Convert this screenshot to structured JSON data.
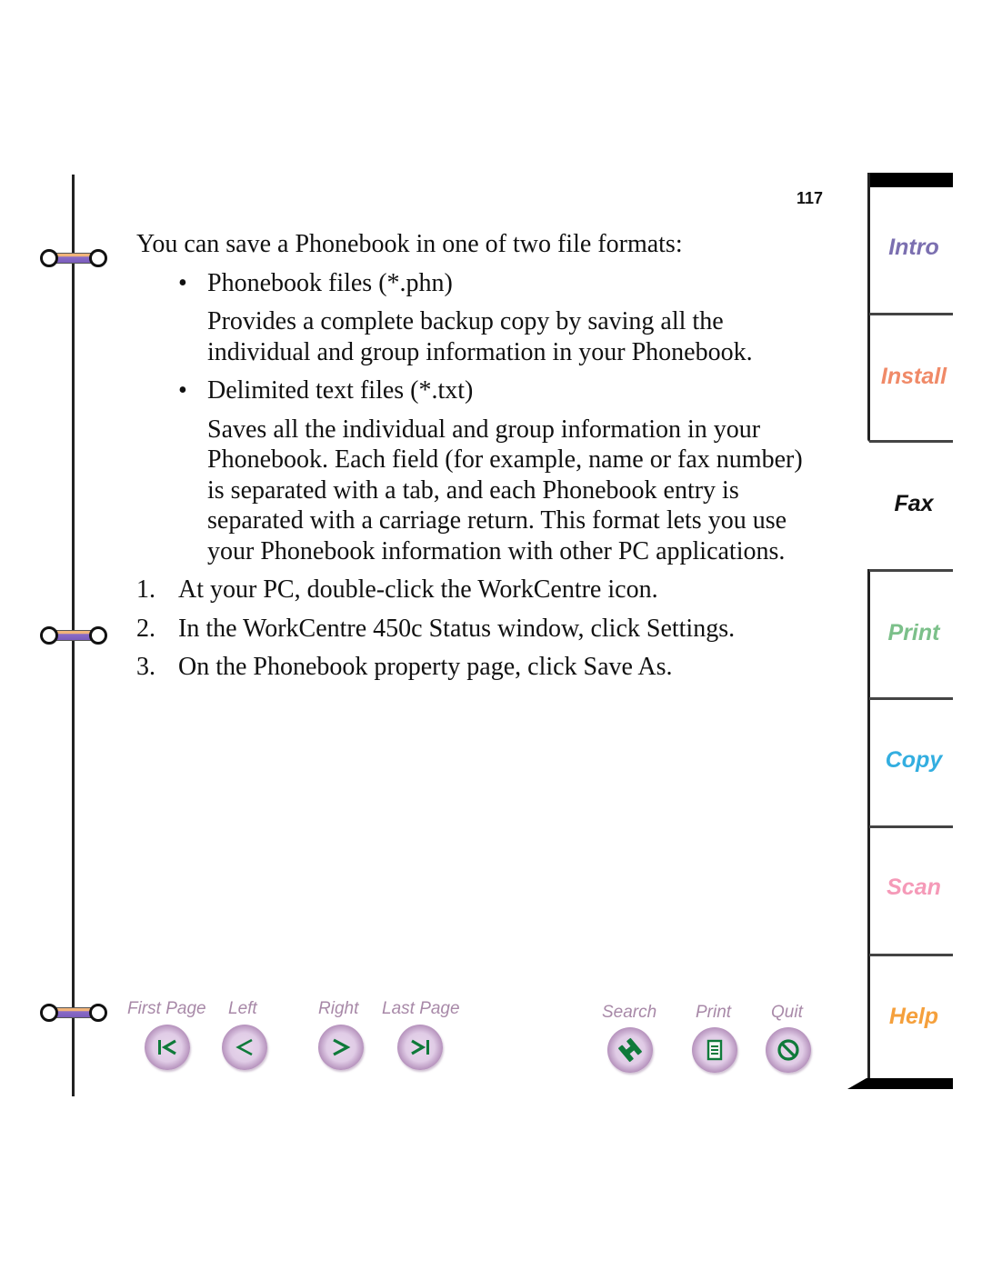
{
  "page": {
    "number": "117"
  },
  "content": {
    "intro": "You can save a Phonebook in one of two file formats:",
    "formats": [
      {
        "bullet": "•",
        "title": "Phonebook files (*.phn)",
        "description": "Provides a complete backup copy by saving all the individual and group information in your Phonebook."
      },
      {
        "bullet": "•",
        "title": "Delimited text files (*.txt)",
        "description": "Saves all the individual and group information in your Phonebook. Each field (for example, name or fax number) is separated with a tab, and each Phonebook entry is separated with a carriage return. This format lets you use your Phonebook information with other PC applications."
      }
    ],
    "steps": [
      {
        "num": "1.",
        "text": "At your PC, double-click the WorkCentre icon."
      },
      {
        "num": "2.",
        "text": "In the WorkCentre 450c Status window, click Settings."
      },
      {
        "num": "3.",
        "text": "On the Phonebook property page, click Save As."
      }
    ]
  },
  "tabs": [
    {
      "label": "Intro",
      "color": "#7b6fb0",
      "active": false
    },
    {
      "label": "Install",
      "color": "#f08a68",
      "active": false
    },
    {
      "label": "Fax",
      "color": "#111111",
      "active": true
    },
    {
      "label": "Print",
      "color": "#7cc08a",
      "active": false
    },
    {
      "label": "Copy",
      "color": "#33aee0",
      "active": false
    },
    {
      "label": "Scan",
      "color": "#f59ab8",
      "active": false
    },
    {
      "label": "Help",
      "color": "#f5a03c",
      "active": false
    }
  ],
  "navigation": {
    "first_page": {
      "label": "First Page",
      "icon": "first-page-icon"
    },
    "left": {
      "label": "Left",
      "icon": "arrow-left-icon"
    },
    "right": {
      "label": "Right",
      "icon": "arrow-right-icon"
    },
    "last_page": {
      "label": "Last Page",
      "icon": "last-page-icon"
    },
    "search": {
      "label": "Search",
      "icon": "binoculars-icon"
    },
    "print": {
      "label": "Print",
      "icon": "document-icon"
    },
    "quit": {
      "label": "Quit",
      "icon": "no-entry-icon"
    }
  },
  "colors": {
    "nav_label": "#a889a8",
    "icon_green": "#0f7a3a",
    "ring_orange": "#f1b47a",
    "ring_purple": "#7a5cbc"
  }
}
